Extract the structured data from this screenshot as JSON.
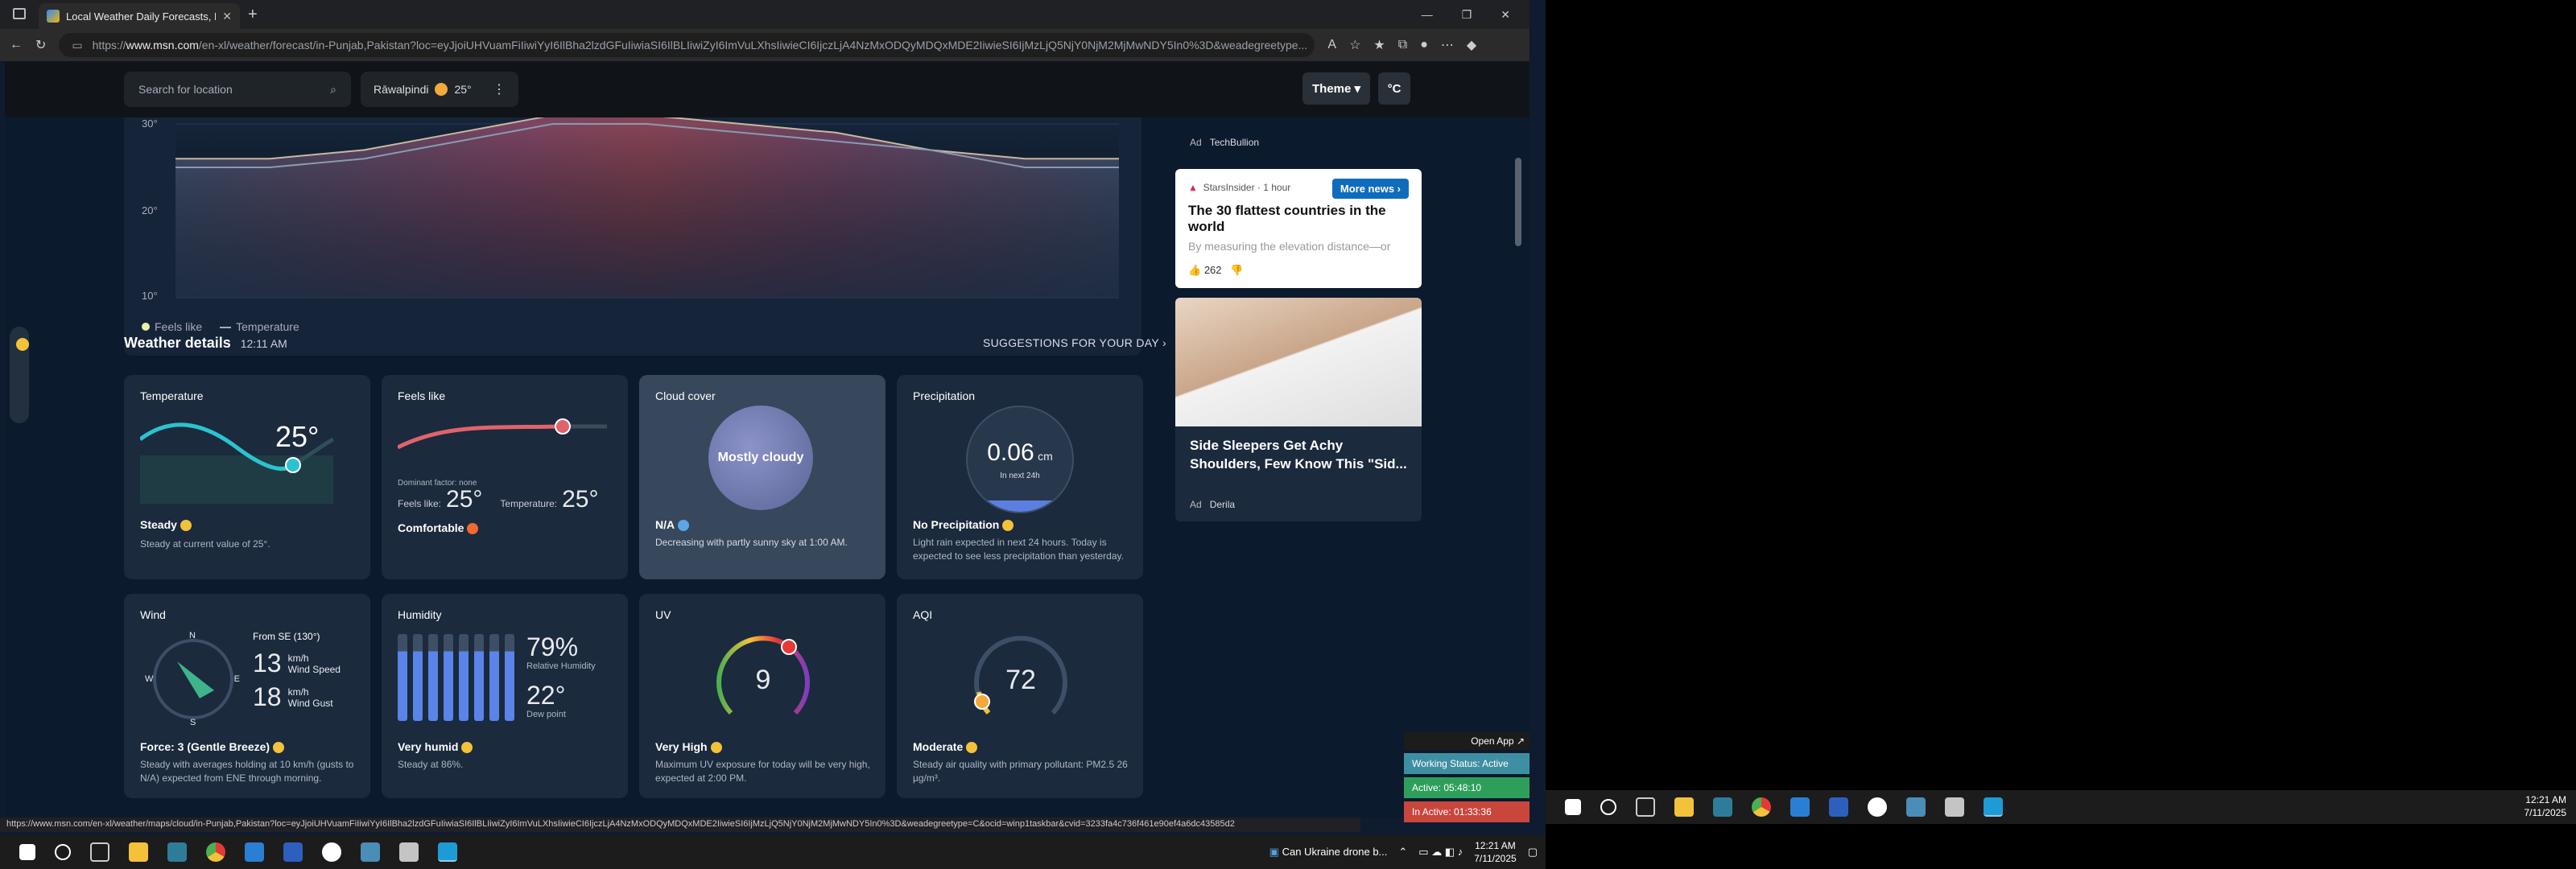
{
  "browser": {
    "tab_title": "Local Weather Daily Forecasts, Ra",
    "url_prefix": "https://",
    "url_host": "www.msn.com",
    "url_path": "/en-xl/weather/forecast/in-Punjab,Pakistan?loc=eyJjoiUHVuamFiIiwiYyI6IlBha2lzdGFuIiwiaSI6IlBLIiwiZyI6ImVuLXhsIiwieCI6IjczLjA4NzMxODQyMDQxMDE2IiwieSI6IjMzLjQ5NjY0NjM2MjMwNDY5In0%3D&weadegreetype..."
  },
  "header": {
    "search_placeholder": "Search for location",
    "location": "Rāwalpindi",
    "location_temp": "25°",
    "theme_label": "Theme",
    "unit_label": "°C"
  },
  "chart": {
    "y_ticks": [
      "30°",
      "20°",
      "10°"
    ],
    "legend": [
      "Feels like",
      "Temperature"
    ]
  },
  "chart_data": {
    "type": "area",
    "series": [
      {
        "name": "Feels like",
        "values": [
          26,
          26,
          27,
          29,
          31,
          31,
          30,
          29,
          27,
          26,
          26
        ]
      },
      {
        "name": "Temperature",
        "values": [
          25,
          25,
          26,
          28,
          30,
          30,
          29,
          28,
          27,
          25,
          25
        ]
      }
    ],
    "ylim": [
      10,
      30
    ]
  },
  "details": {
    "title": "Weather details",
    "time": "12:11 AM",
    "suggestions": "SUGGESTIONS FOR YOUR DAY"
  },
  "cards": {
    "temperature": {
      "title": "Temperature",
      "value": "25°",
      "status": "Steady",
      "desc": "Steady at current value of 25°."
    },
    "feels": {
      "title": "Feels like",
      "factor": "Dominant factor: none",
      "feels_label": "Feels like:",
      "feels_value": "25°",
      "temp_label": "Temperature:",
      "temp_value": "25°",
      "status": "Comfortable"
    },
    "cloud": {
      "title": "Cloud cover",
      "value": "Mostly cloudy",
      "status": "N/A",
      "desc": "Decreasing with partly sunny sky at 1:00 AM."
    },
    "precip": {
      "title": "Precipitation",
      "value": "0.06",
      "unit": "cm",
      "sub": "In next 24h",
      "status": "No Precipitation",
      "desc": "Light rain expected in next 24 hours. Today is expected to see less precipitation than yesterday."
    },
    "wind": {
      "title": "Wind",
      "from": "From SE (130°)",
      "speed": "13",
      "speed_unit": "km/h",
      "speed_label": "Wind Speed",
      "gust": "18",
      "gust_unit": "km/h",
      "gust_label": "Wind Gust",
      "n": "N",
      "e": "E",
      "s": "S",
      "w": "W",
      "status": "Force: 3 (Gentle Breeze)",
      "desc": "Steady with averages holding at 10 km/h (gusts to N/A) expected from ENE through morning."
    },
    "humidity": {
      "title": "Humidity",
      "value": "79%",
      "label": "Relative Humidity",
      "dew": "22°",
      "dew_label": "Dew point",
      "status": "Very humid",
      "desc": "Steady at 86%."
    },
    "uv": {
      "title": "UV",
      "value": "9",
      "status": "Very High",
      "desc": "Maximum UV exposure for today will be very high, expected at 2:00 PM."
    },
    "aqi": {
      "title": "AQI",
      "value": "72",
      "status": "Moderate",
      "desc": "Steady air quality with primary pollutant: PM2.5 26 µg/m³."
    }
  },
  "right": {
    "ad1": "Ad",
    "ad1_src": "TechBullion",
    "news_src": "StarsInsider · 1 hour",
    "more_news": "More news",
    "news_title": "The 30 flattest countries in the world",
    "news_sub": "By measuring the elevation distance—or",
    "likes": "262",
    "ad2_title": "Side Sleepers Get Achy Shoulders, Few Know This \"Sid...",
    "ad2": "Ad",
    "ad2_src": "Derila"
  },
  "status_url": "https://www.msn.com/en-xl/weather/maps/cloud/in-Punjab,Pakistan?loc=eyJjoiUHVuamFiIiwiYyI6IlBha2lzdGFuIiwiaSI6IlBLIiwiZyI6ImVuLXhsIiwieCI6IjczLjA4NzMxODQyMDQxMDE2IiwieSI6IjMzLjQ5NjY0NjM2MjMwNDY5In0%3D&weadegreetype=C&ocid=winp1taskbar&cvid=3233fa4c736f461e90ef4a6dc43585d2",
  "taskbar": {
    "news": "Can Ukraine drone b...",
    "time": "12:21 AM",
    "date": "7/11/2025"
  },
  "popup": {
    "open_app": "Open App",
    "working": "Working Status: Active",
    "active": "Active: 05:48:10",
    "inactive": "In Active: 01:33:36"
  }
}
